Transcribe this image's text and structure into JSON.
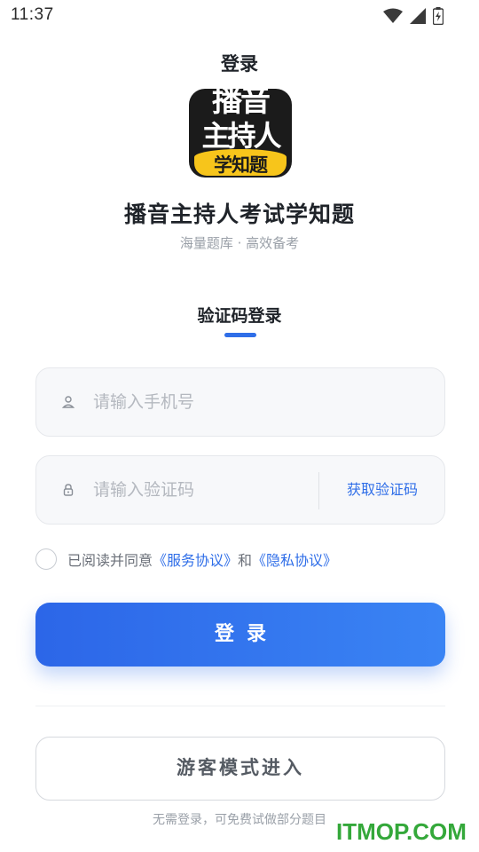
{
  "status_bar": {
    "time": "11:37"
  },
  "page": {
    "title": "登录"
  },
  "app": {
    "logo_line1": "播音",
    "logo_line2": "主持人",
    "logo_line3": "学知题",
    "name": "播音主持人考试学知题",
    "slogan": "海量题库 · 高效备考"
  },
  "login": {
    "tab_label": "验证码登录",
    "phone_placeholder": "请输入手机号",
    "code_placeholder": "请输入验证码",
    "get_code_label": "获取验证码",
    "agree_prefix": "已阅读并同意",
    "service_link": "《服务协议》",
    "agree_and": "和",
    "privacy_link": "《隐私协议》",
    "submit_label": "登录",
    "guest_label": "游客模式进入",
    "guest_note": "无需登录，可免费试做部分题目"
  },
  "watermark": "ITMOP.COM",
  "colors": {
    "accent": "#2f6ee8",
    "logo_yellow": "#f7c51b",
    "watermark_green": "#34a83a"
  }
}
